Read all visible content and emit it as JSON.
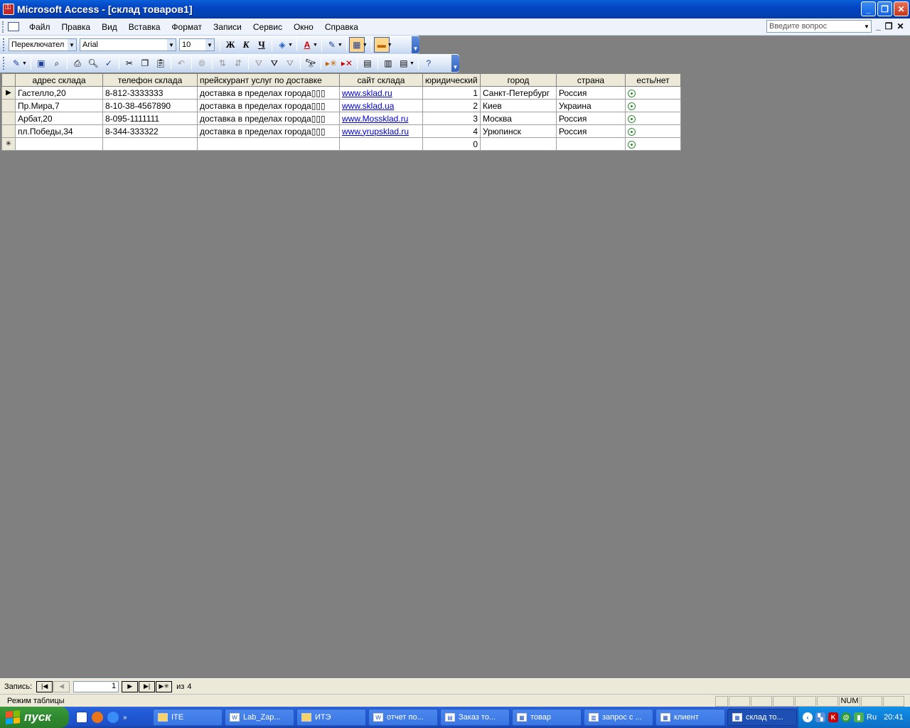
{
  "window": {
    "title": "Microsoft Access - [склад товаров1]"
  },
  "menu": {
    "items": [
      "Файл",
      "Правка",
      "Вид",
      "Вставка",
      "Формат",
      "Записи",
      "Сервис",
      "Окно",
      "Справка"
    ],
    "help_placeholder": "Введите вопрос"
  },
  "format_toolbar": {
    "object_combo": "Переключател",
    "font_combo": "Arial",
    "size_combo": "10",
    "bold": "Ж",
    "italic": "К",
    "underline": "Ч",
    "font_color_glyph": "A"
  },
  "table": {
    "columns": [
      "адрес склада",
      "телефон склада",
      "прейскурант услуг  по доставке",
      "сайт  склада",
      "юридический",
      "город",
      "страна",
      "есть/нет"
    ],
    "rows": [
      {
        "address": "Гастелло,20",
        "phone": "8-812-3333333",
        "price": "доставка в пределах города▯▯▯",
        "site": "www.sklad.ru",
        "legal": "1",
        "city": "Санкт-Петербург",
        "country": "Россия"
      },
      {
        "address": "Пр.Мира,7",
        "phone": "8-10-38-4567890",
        "price": "доставка в пределах города▯▯▯",
        "site": "www.sklad.ua",
        "legal": "2",
        "city": "Киев",
        "country": "Украина"
      },
      {
        "address": "Арбат,20",
        "phone": "8-095-1111111",
        "price": "доставка в пределах города▯▯▯",
        "site": "www.Mossklad.ru",
        "legal": "3",
        "city": "Москва",
        "country": "Россия"
      },
      {
        "address": "пл.Победы,34",
        "phone": "8-344-333322",
        "price": "доставка в пределах города▯▯▯",
        "site": "www.yrupsklad.ru",
        "legal": "4",
        "city": "Урюпинск",
        "country": "Россия"
      }
    ],
    "new_row_legal": "0",
    "current_row_marker": "▶",
    "new_row_marker": "✳"
  },
  "record_nav": {
    "label": "Запись:",
    "current": "1",
    "of_label": "из",
    "total": "4"
  },
  "status": {
    "mode": "Режим таблицы",
    "num": "NUM"
  },
  "taskbar": {
    "start_label": "пуск",
    "tasks": [
      "ITE",
      "Lab_Zap...",
      "ИТЭ",
      "отчет по...",
      "Заказ то...",
      "товар",
      "запрос с ...",
      "клиент",
      "склад то..."
    ],
    "active_task": "склад то...",
    "lang": "Ru",
    "clock": "20:41"
  },
  "colors": {
    "titlebar": "#0345c2",
    "workspace": "#808080",
    "link": "#0000cc",
    "taskbar": "#245edb",
    "start": "#2f8a2f"
  }
}
